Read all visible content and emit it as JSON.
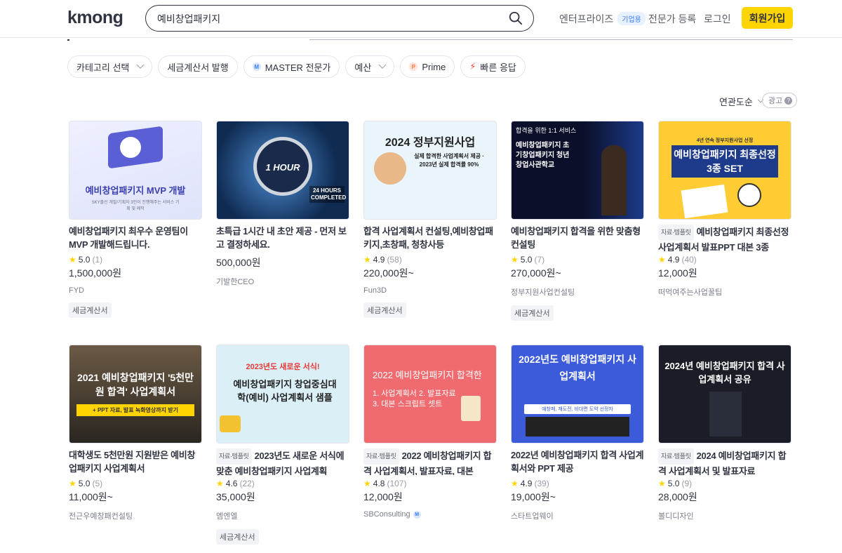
{
  "header": {
    "logo": "kmong",
    "search_value": "예비창업패키지",
    "nav_enterprise": "엔터프라이즈",
    "enterprise_badge": "기업용",
    "nav_expert": "전문가 등록",
    "nav_login": "로그인",
    "signup": "회원가입"
  },
  "filters": {
    "category": "카테고리 선택",
    "tax_invoice": "세금계산서 발행",
    "master": "MASTER 전문가",
    "budget": "예산",
    "prime": "Prime",
    "fast": "빠른 응답"
  },
  "sort": {
    "label": "연관도순",
    "ad": "광고"
  },
  "colors": {
    "accent": "#ffd400",
    "master_blue": "#3b7cff",
    "star": "#ffd400"
  },
  "cards": [
    {
      "thumb_title": "예비창업패키지 MVP 개발",
      "thumb_sub": "SKY출신 개발/기획자 3인이 진행해주는 서비스 기획 및 제작",
      "title": "예비창업패키지 최우수 운영팀이 MVP 개발해드립니다.",
      "rating": "5.0",
      "count": "(1)",
      "price": "1,500,000원",
      "seller": "FYD",
      "tax": "세금계산서"
    },
    {
      "thumb_title": "1 HOUR",
      "thumb_sub": "24 HOURS COMPLETED",
      "title": "초특급 1시간 내 초안 제공 - 먼저 보고 결정하세요.",
      "rating": "",
      "count": "",
      "price": "500,000원",
      "seller": "기발한CEO",
      "tax": ""
    },
    {
      "thumb_title": "2024 정부지원사업",
      "thumb_sub": "실제 합격한 사업계획서 제공 · 2023년 실제 합격률 90%",
      "title": "합격 사업계획서 컨설팅,예비창업패키지,초창패, 청창사등",
      "rating": "4.9",
      "count": "(58)",
      "price": "220,000원~",
      "seller": "Fun3D",
      "tax": "세금계산서"
    },
    {
      "thumb_title": "합격을 위한 1:1 서비스",
      "thumb_sub": "예비창업패키지 초기창업패키지 청년창업사관학교",
      "title": "예비창업패키지 합격을 위한 맞춤형 컨설팅",
      "rating": "5.0",
      "count": "(7)",
      "price": "270,000원~",
      "seller": "정부지원사업컨설팅",
      "tax": "세금계산서"
    },
    {
      "thumb_title": "예비창업패키지 최종선정 3종 SET",
      "thumb_sub": "4년 연속 정부지원사업 선정",
      "tag": "자료·템플릿",
      "title": "예비창업패키지 최종선정 사업계획서 발표PPT 대본 3종",
      "rating": "4.9",
      "count": "(40)",
      "price": "12,000원",
      "seller": "떠먹여주는사업꿀팁",
      "tax": ""
    },
    {
      "thumb_title": "2021 예비창업패키지 '5천만원 합격' 사업계획서",
      "thumb_sub": "+ PPT 자료, 발표 녹화영상까지 받기",
      "title": "대학생도 5천만원 지원받은 예비창업패키지 사업계획서",
      "rating": "5.0",
      "count": "(5)",
      "price": "11,000원~",
      "seller": "전근우예창패컨설팅",
      "tax": ""
    },
    {
      "thumb_title": "예비창업패키지 창업중심대학(예비) 사업계획서 샘플",
      "thumb_sub": "2023년도 새로운 서식!",
      "tag": "자료·템플릿",
      "title": "2023년도 새로운 서식에 맞춘 예비창업패키지 사업계획",
      "rating": "4.6",
      "count": "(22)",
      "price": "35,000원",
      "seller": "엠엔엘",
      "tax": "세금계산서"
    },
    {
      "thumb_title": "2022 예비창업패키지 합격한",
      "thumb_sub": "1. 사업계획서 2. 발표자료 3. 대본 스크립트 셋트",
      "tag": "자료·템플릿",
      "title": "2022 예비창업패키지 합격 사업계획서, 발표자료, 대본",
      "rating": "4.8",
      "count": "(107)",
      "price": "12,000원",
      "seller": "SBConsulting",
      "tax": ""
    },
    {
      "thumb_title": "2022년도 예비창업패키지 사업계획서",
      "thumb_sub": "예창패, 재도전, 비대면 도약 선정자",
      "title": "2022년 예비창업패키지 합격 사업계획서와 PPT 제공",
      "rating": "4.9",
      "count": "(39)",
      "price": "19,000원~",
      "seller": "스타트업웨이",
      "tax": ""
    },
    {
      "thumb_title": "2024년 예비창업패키지 합격 사업계획서 공유",
      "thumb_sub": "",
      "tag": "자료·템플릿",
      "title": "2024 예비창업패키지 합격 사업계획서 및 발표자료",
      "rating": "5.0",
      "count": "(9)",
      "price": "28,000원",
      "seller": "볼디디자인",
      "tax": ""
    }
  ]
}
